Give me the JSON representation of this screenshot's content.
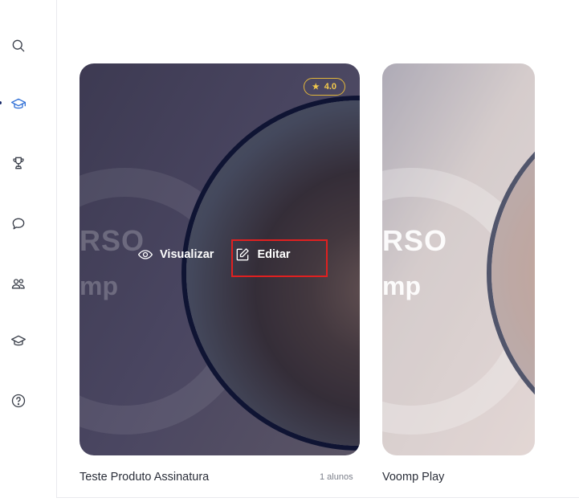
{
  "sidebar": {
    "items": [
      {
        "name": "search",
        "icon": "search-icon"
      },
      {
        "name": "courses",
        "icon": "graduation-cap-icon",
        "active": true
      },
      {
        "name": "achievements",
        "icon": "trophy-icon"
      },
      {
        "name": "chat",
        "icon": "chat-bubble-icon"
      },
      {
        "name": "community",
        "icon": "users-icon"
      },
      {
        "name": "learning",
        "icon": "graduation-cap-outline-icon"
      },
      {
        "name": "help",
        "icon": "question-circle-icon"
      }
    ],
    "active_color": "#2f6fd6"
  },
  "cards": [
    {
      "title": "Teste Produto Assinatura",
      "students": "1 alunos",
      "rating": "4.0",
      "brand_line_1": "RSO",
      "brand_line_2": "mp",
      "actions": {
        "view_label": "Visualizar",
        "edit_label": "Editar"
      }
    },
    {
      "title": "Voomp Play",
      "brand_line_1": "RSO",
      "brand_line_2": "mp"
    }
  ],
  "colors": {
    "rating": "#f2c94c",
    "highlight": "#e02020",
    "ring": "#0f1433"
  }
}
